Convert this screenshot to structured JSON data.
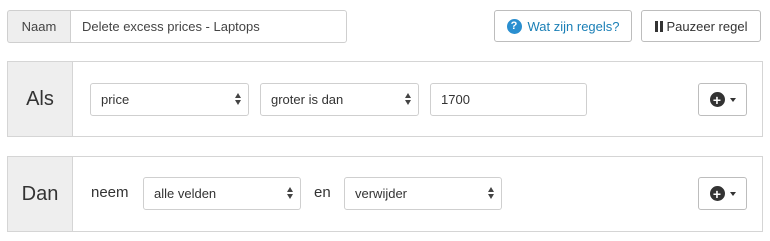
{
  "name_row": {
    "label": "Naam",
    "value": "Delete excess prices - Laptops"
  },
  "header_buttons": {
    "rules_icon": "question-circle-icon",
    "rules_label": "Wat zijn regels?",
    "pause_icon": "pause-icon",
    "pause_label": "Pauzeer regel"
  },
  "if_rule": {
    "label": "Als",
    "field": "price",
    "operator": "groter is dan",
    "value": "1700",
    "add_icon": "plus-circle-icon"
  },
  "then_rule": {
    "label": "Dan",
    "word_take": "neem",
    "fields": "alle velden",
    "word_and": "en",
    "action": "verwijder",
    "add_icon": "plus-circle-icon"
  },
  "colors": {
    "accent": "#1a7fb6",
    "help_icon": "#2a8fd0",
    "label_bg": "#eeeeee",
    "border": "#cfcfcf"
  }
}
